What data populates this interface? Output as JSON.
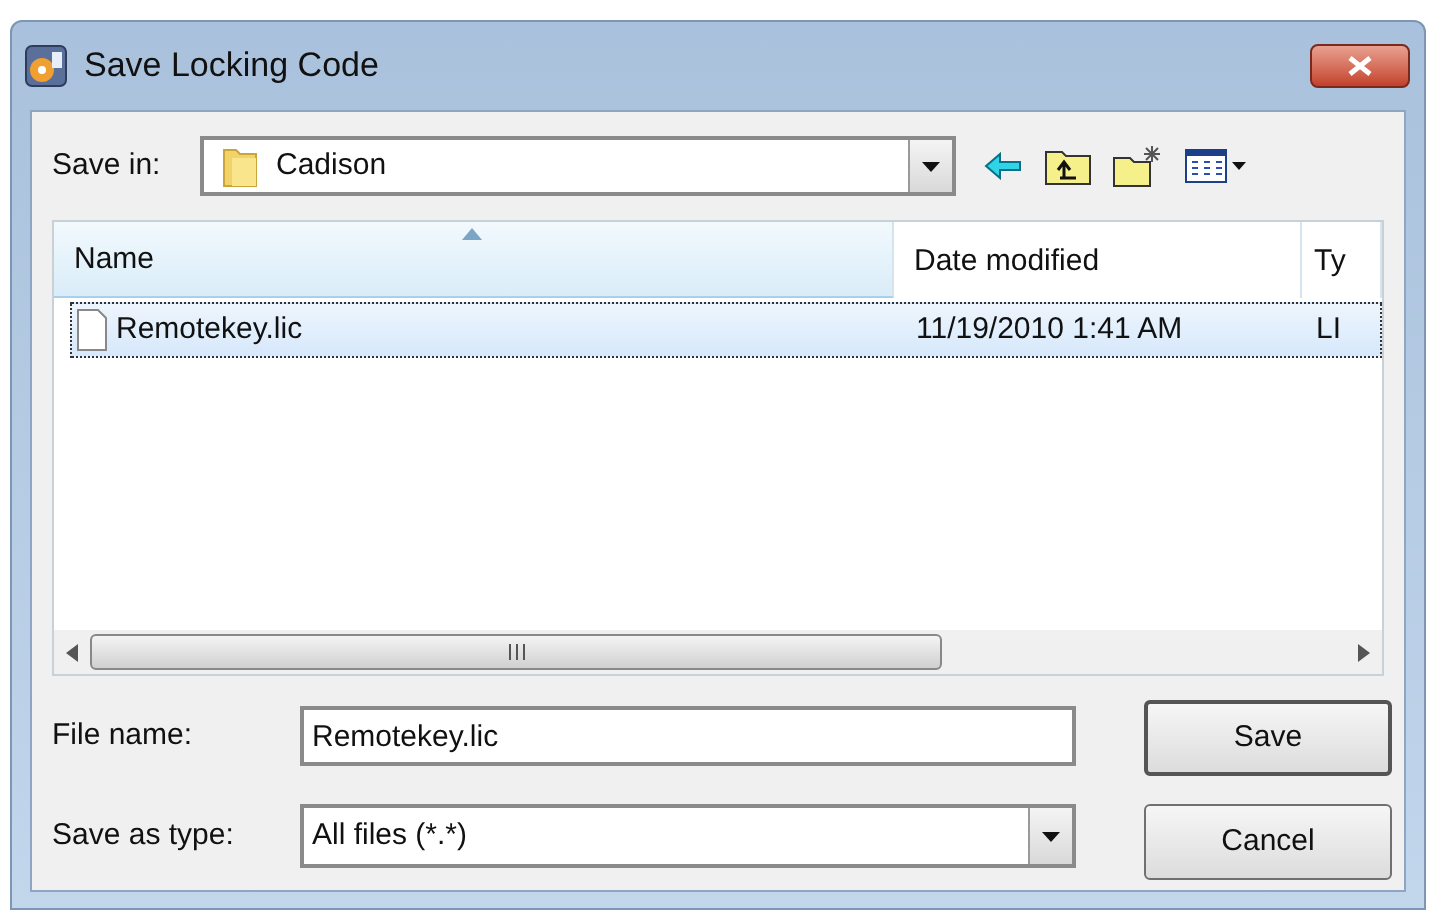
{
  "window": {
    "title": "Save Locking Code"
  },
  "save_in": {
    "label": "Save in:",
    "value": "Cadison"
  },
  "file_list": {
    "columns": [
      {
        "label": "Name",
        "sorted": true
      },
      {
        "label": "Date modified",
        "sorted": false
      },
      {
        "label": "Ty",
        "sorted": false
      }
    ],
    "rows": [
      {
        "cells": [
          "Remotekey.lic",
          "11/19/2010 1:41 AM",
          "LI"
        ],
        "selected": true
      }
    ]
  },
  "file_name": {
    "label": "File name:",
    "value": "Remotekey.lic"
  },
  "save_as_type": {
    "label": "Save as type:",
    "value": "All files (*.*)"
  },
  "buttons": [
    {
      "label": "Save",
      "kind": "default"
    },
    {
      "label": "Cancel",
      "kind": "normal"
    }
  ]
}
